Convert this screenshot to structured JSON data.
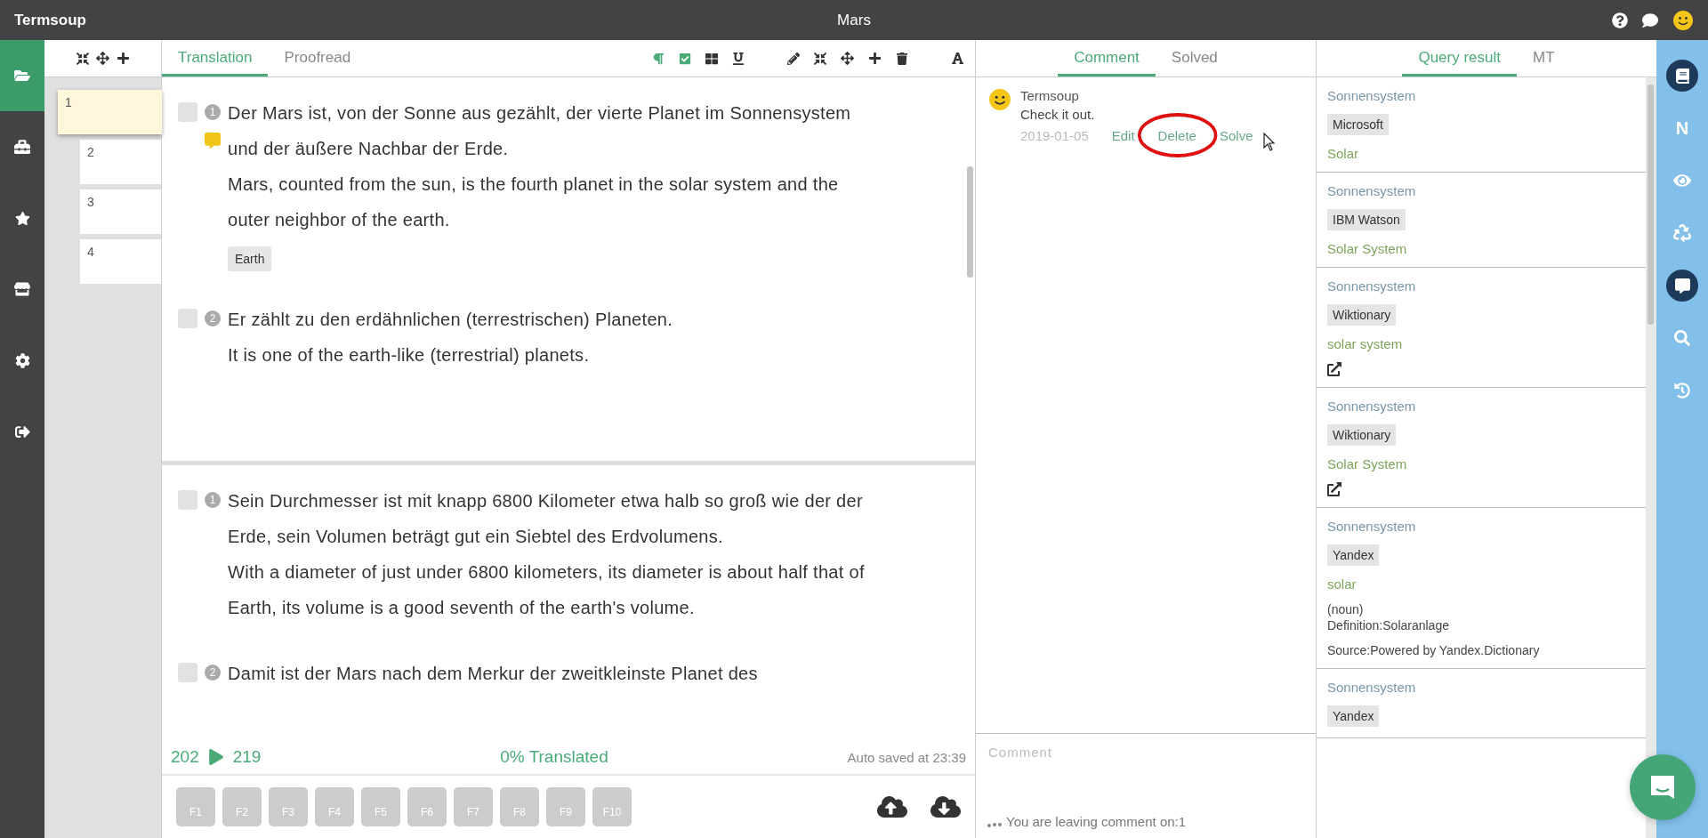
{
  "app": {
    "name": "Termsoup",
    "document_title": "Mars"
  },
  "nav": [
    {
      "kind": "folder",
      "selected": true
    },
    {
      "kind": "toolbox",
      "selected": false
    },
    {
      "kind": "star",
      "selected": false
    },
    {
      "kind": "store",
      "selected": false
    },
    {
      "kind": "settings",
      "selected": false
    },
    {
      "kind": "logout",
      "selected": false
    }
  ],
  "segment_list": {
    "cards": [
      {
        "number": "1",
        "selected": true
      },
      {
        "number": "2",
        "selected": false
      },
      {
        "number": "3",
        "selected": false
      },
      {
        "number": "4",
        "selected": false
      }
    ]
  },
  "editor": {
    "tabs": [
      {
        "label": "Translation",
        "selected": true
      },
      {
        "label": "Proofread",
        "selected": false
      }
    ],
    "blocks": [
      {
        "segments": [
          {
            "number": "1",
            "checked": false,
            "has_comment": true,
            "source": "Der Mars ist, von der Sonne aus gezählt, der vierte Planet im Sonnensystem und der äußere Nachbar der Erde.",
            "target": "Mars, counted from the sun, is the fourth planet in the solar system and the outer neighbor of the earth.",
            "terms": [
              "Earth"
            ]
          },
          {
            "number": "2",
            "checked": false,
            "has_comment": false,
            "source": "Er zählt zu den erdähnlichen (terrestrischen) Planeten.",
            "target": "It is one of the earth-like (terrestrial) planets."
          }
        ]
      },
      {
        "segments": [
          {
            "number": "1",
            "checked": false,
            "has_comment": false,
            "source": "Sein Durchmesser ist mit knapp 6800 Kilometer etwa halb so groß wie der der Erde, sein Volumen beträgt gut ein Siebtel des Erdvolumens.",
            "target": "With a diameter of just under 6800 kilometers, its diameter is about half that of Earth, its volume is a good seventh of the earth's volume."
          },
          {
            "number": "2",
            "checked": false,
            "has_comment": false,
            "source": "Damit ist der Mars nach dem Merkur der zweitkleinste Planet des"
          }
        ]
      }
    ],
    "status": {
      "from": "202",
      "to": "219",
      "progress": "0% Translated",
      "saved": "Auto saved at 23:39"
    },
    "function_keys": [
      "F1",
      "F2",
      "F3",
      "F4",
      "F5",
      "F6",
      "F7",
      "F8",
      "F9",
      "F10"
    ]
  },
  "comments": {
    "tabs": [
      {
        "label": "Comment",
        "selected": true
      },
      {
        "label": "Solved",
        "selected": false
      }
    ],
    "items": [
      {
        "author": "Termsoup",
        "text": "Check it out.",
        "date": "2019-01-05",
        "actions": [
          "Edit",
          "Delete",
          "Solve"
        ]
      }
    ],
    "input": {
      "placeholder": "Comment",
      "note": "You are leaving comment on:1"
    }
  },
  "query": {
    "tabs": [
      {
        "label": "Query result",
        "selected": true
      },
      {
        "label": "MT",
        "selected": false
      }
    ],
    "results": [
      {
        "term": "Sonnensystem",
        "source": "Microsoft",
        "translation": "Solar",
        "link": false
      },
      {
        "term": "Sonnensystem",
        "source": "IBM Watson",
        "translation": "Solar System",
        "link": false
      },
      {
        "term": "Sonnensystem",
        "source": "Wiktionary",
        "translation": "solar system",
        "link": true
      },
      {
        "term": "Sonnensystem",
        "source": "Wiktionary",
        "translation": "Solar System",
        "link": true
      },
      {
        "term": "Sonnensystem",
        "source": "Yandex",
        "translation": "solar",
        "link": false,
        "details": [
          "(noun)",
          "Definition:Solaranlage"
        ],
        "note": "Source:Powered by Yandex.Dictionary"
      },
      {
        "term": "Sonnensystem",
        "source": "Yandex",
        "link": false
      }
    ]
  },
  "right_bar": [
    {
      "kind": "book",
      "active": true
    },
    {
      "kind": "letter",
      "label": "N",
      "active": false
    },
    {
      "kind": "eye",
      "active": false
    },
    {
      "kind": "recycle",
      "active": false
    },
    {
      "kind": "chat",
      "active": true
    },
    {
      "kind": "search",
      "active": false
    },
    {
      "kind": "history",
      "active": false
    }
  ]
}
